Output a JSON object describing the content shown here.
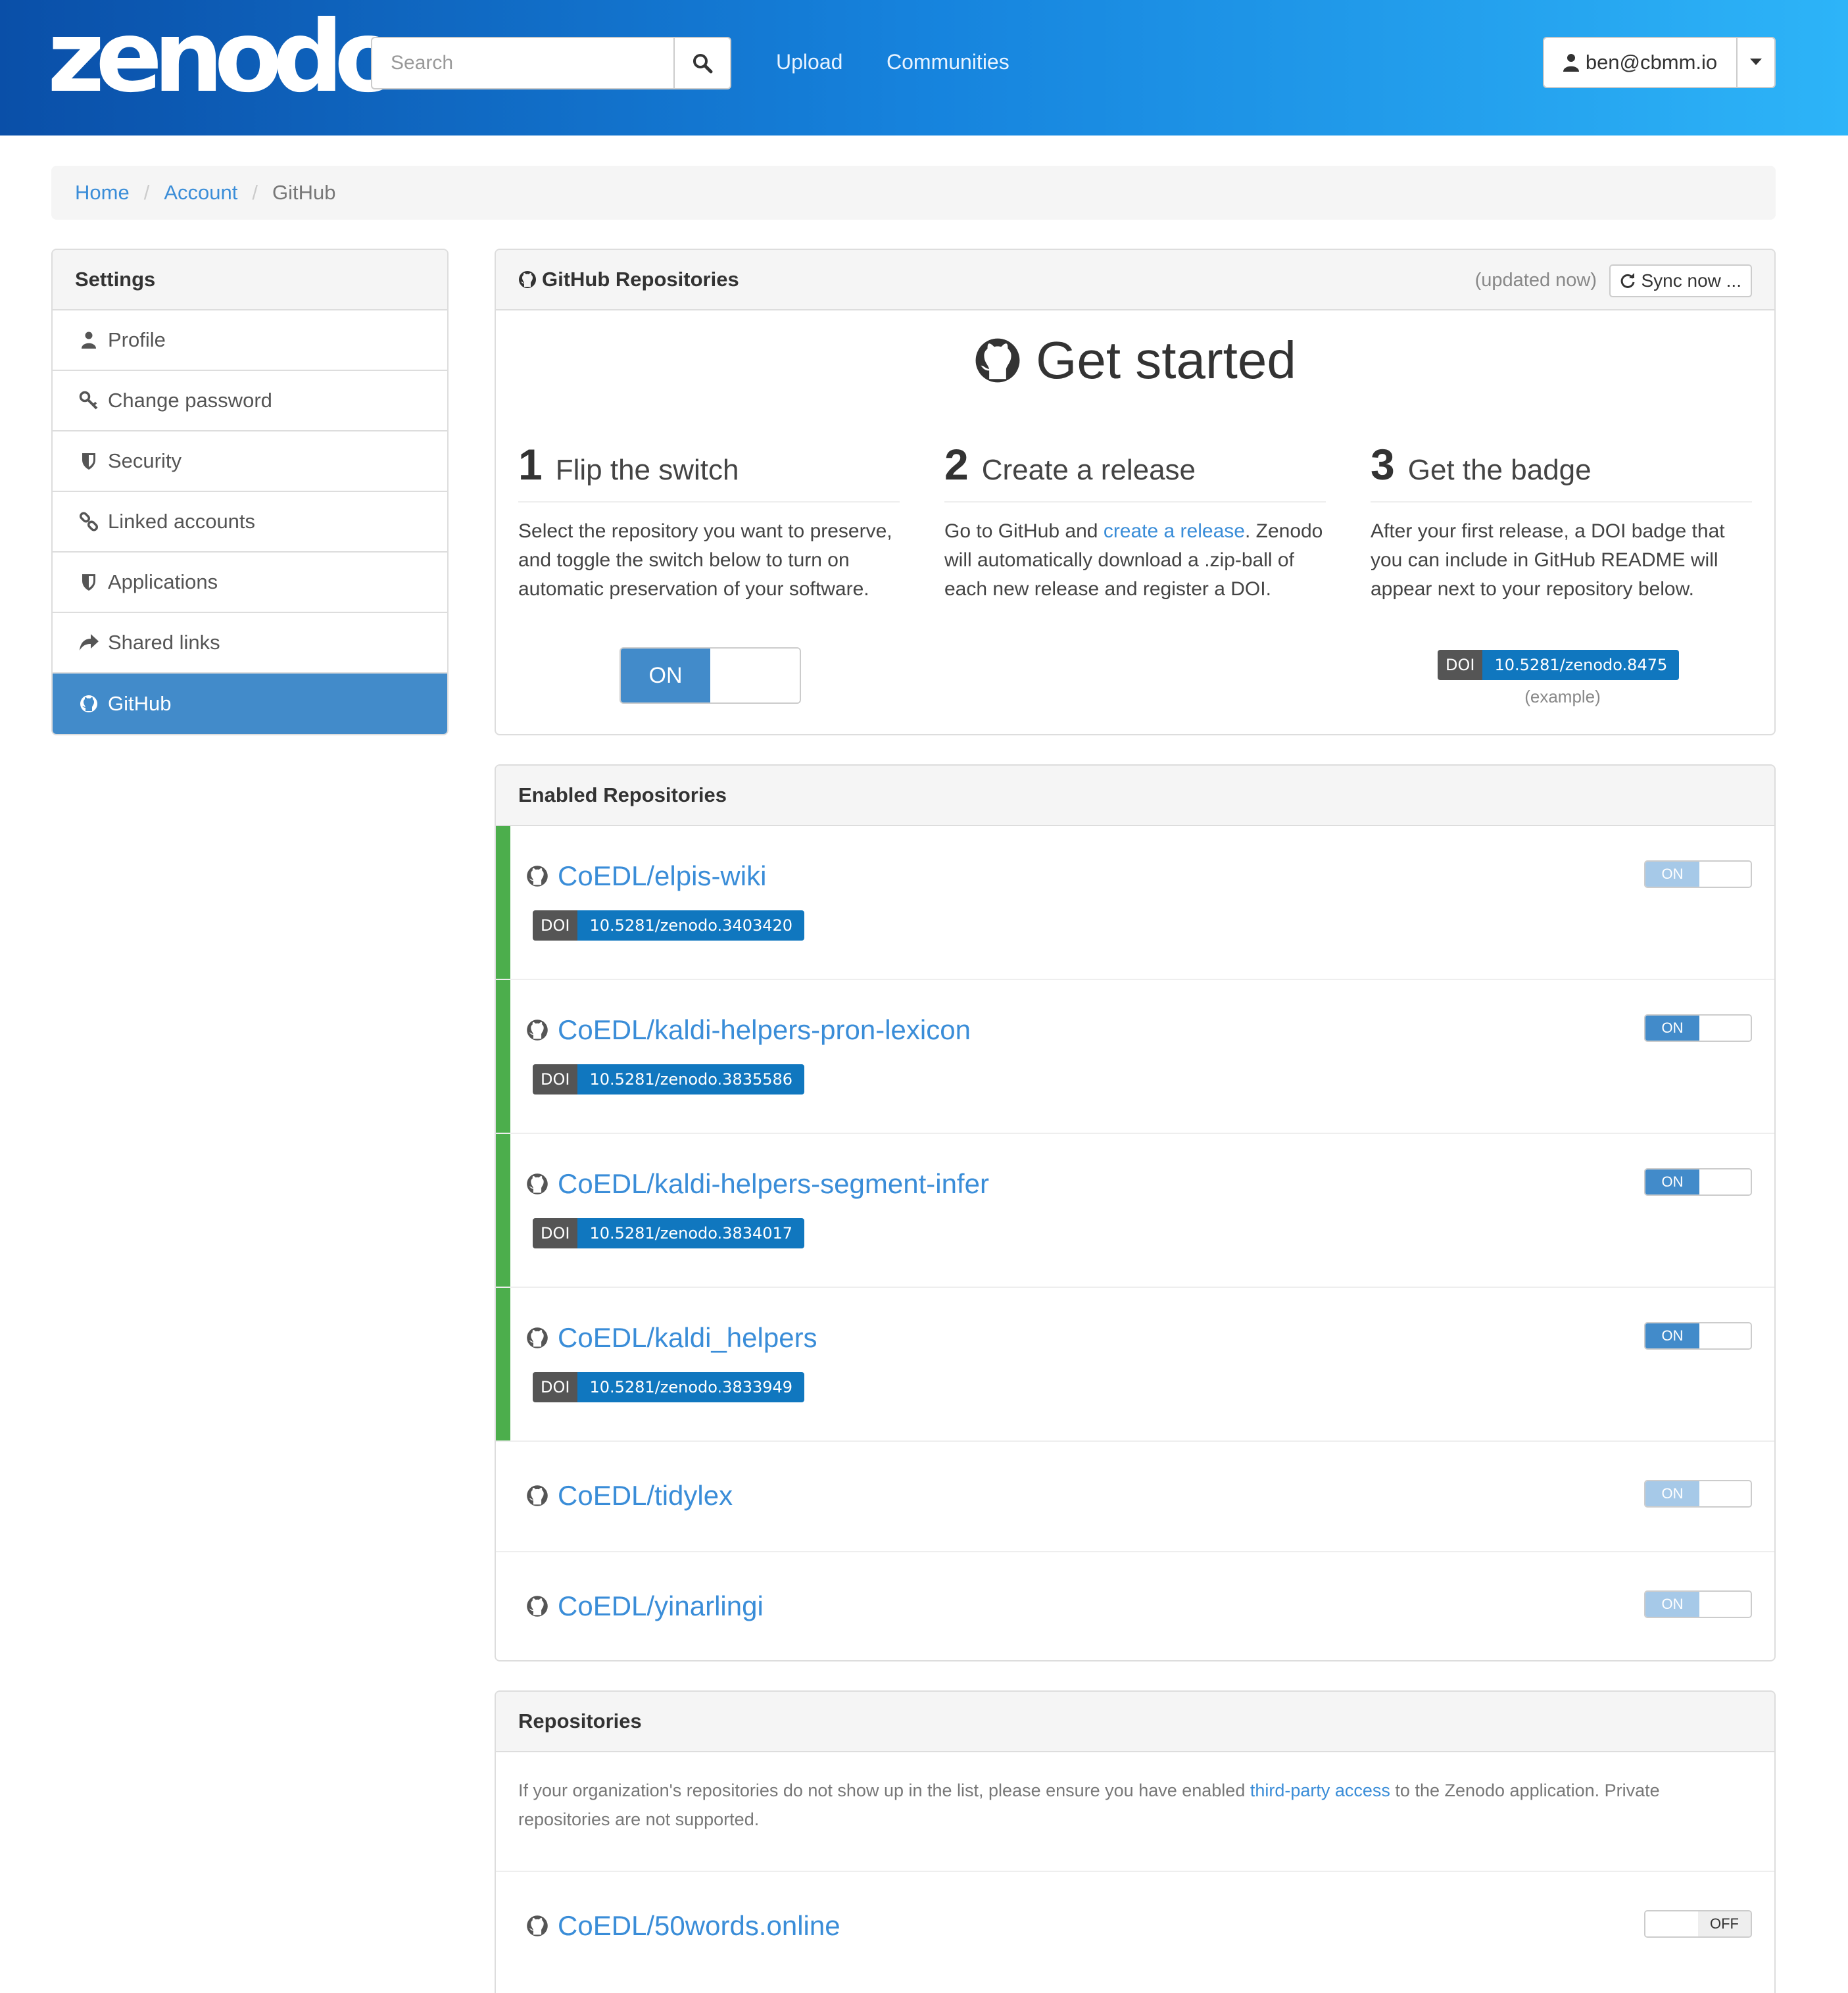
{
  "header": {
    "logo": "zenodo",
    "search_placeholder": "Search",
    "nav": [
      "Upload",
      "Communities"
    ],
    "user": "ben@cbmm.io",
    "colors": {
      "gradient_start": "#0a4fa8",
      "gradient_end": "#2db4f8"
    }
  },
  "breadcrumb": [
    "Home",
    "Account",
    "GitHub"
  ],
  "sidebar": {
    "title": "Settings",
    "items": [
      {
        "label": "Profile",
        "icon": "user-icon"
      },
      {
        "label": "Change password",
        "icon": "key-icon"
      },
      {
        "label": "Security",
        "icon": "shield-icon"
      },
      {
        "label": "Linked accounts",
        "icon": "link-icon"
      },
      {
        "label": "Applications",
        "icon": "shield-icon"
      },
      {
        "label": "Shared links",
        "icon": "share-icon"
      },
      {
        "label": "GitHub",
        "icon": "github-icon",
        "active": true
      }
    ]
  },
  "github_panel": {
    "title": "GitHub Repositories",
    "updated": "(updated now)",
    "sync_label": "Sync now ...",
    "heading": "Get started",
    "steps": [
      {
        "num": "1",
        "title": "Flip the switch",
        "text": "Select the repository you want to preserve, and toggle the switch below to turn on automatic preservation of your software."
      },
      {
        "num": "2",
        "title": "Create a release",
        "text_before": "Go to GitHub and ",
        "link": "create a release",
        "text_after": ". Zenodo will automatically download a .zip-ball of each new release and register a DOI."
      },
      {
        "num": "3",
        "title": "Get the badge",
        "text": "After your first release, a DOI badge that you can include in GitHub README will appear next to your repository below."
      }
    ],
    "toggle_on": "ON",
    "example_badge": {
      "left": "DOI",
      "right": "10.5281/zenodo.8475"
    },
    "example_label": "(example)"
  },
  "enabled_panel": {
    "title": "Enabled Repositories",
    "repos": [
      {
        "name": "CoEDL/elpis-wiki",
        "doi": "10.5281/zenodo.3403420",
        "toggle": "ON",
        "faded": true
      },
      {
        "name": "CoEDL/kaldi-helpers-pron-lexicon",
        "doi": "10.5281/zenodo.3835586",
        "toggle": "ON",
        "faded": false
      },
      {
        "name": "CoEDL/kaldi-helpers-segment-infer",
        "doi": "10.5281/zenodo.3834017",
        "toggle": "ON",
        "faded": false
      },
      {
        "name": "CoEDL/kaldi_helpers",
        "doi": "10.5281/zenodo.3833949",
        "toggle": "ON",
        "faded": false
      },
      {
        "name": "CoEDL/tidylex",
        "doi": null,
        "toggle": "ON",
        "faded": true
      },
      {
        "name": "CoEDL/yinarlingi",
        "doi": null,
        "toggle": "ON",
        "faded": true
      }
    ],
    "doi_label": "DOI"
  },
  "repos_panel": {
    "title": "Repositories",
    "note_before": "If your organization's repositories do not show up in the list, please ensure you have enabled ",
    "note_link": "third-party access",
    "note_after": " to the Zenodo application. Private repositories are not supported.",
    "repos": [
      {
        "name": "CoEDL/50words.online",
        "toggle": "OFF"
      }
    ]
  }
}
